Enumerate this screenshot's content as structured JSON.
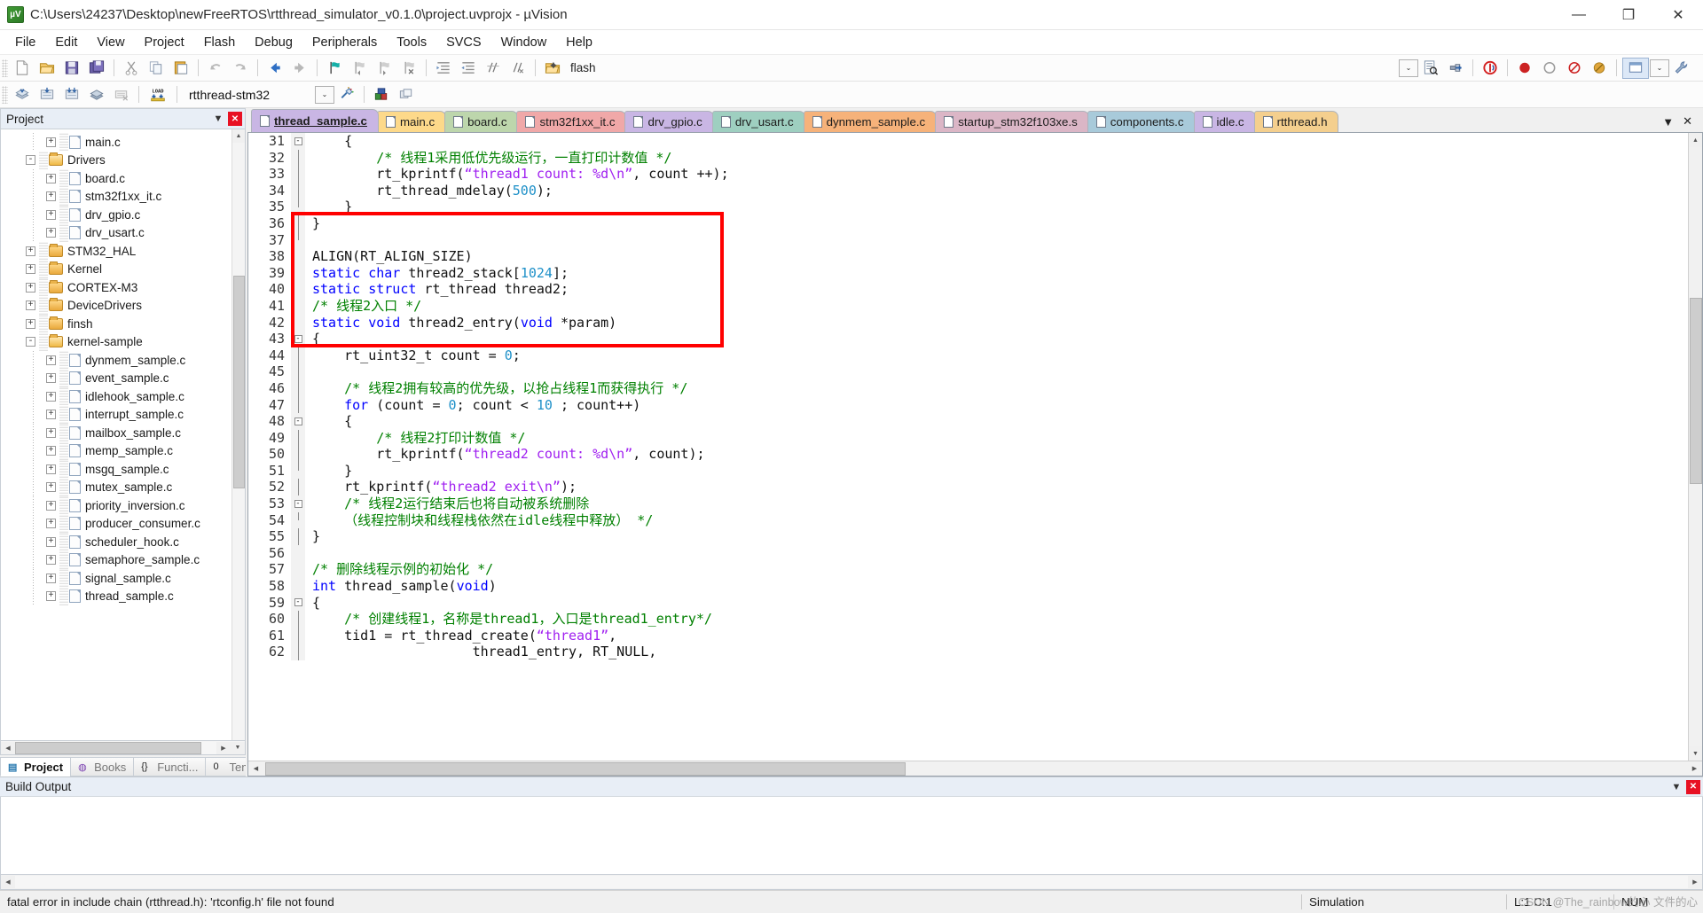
{
  "window": {
    "title": "C:\\Users\\24237\\Desktop\\newFreeRTOS\\rtthread_simulator_v0.1.0\\project.uvprojx - µVision",
    "app_icon_text": "µV",
    "minimize": "—",
    "maximize": "❐",
    "close": "✕"
  },
  "menu": {
    "items": [
      "File",
      "Edit",
      "View",
      "Project",
      "Flash",
      "Debug",
      "Peripherals",
      "Tools",
      "SVCS",
      "Window",
      "Help"
    ]
  },
  "toolbar": {
    "flash_label": "flash",
    "target_name": "rtthread-stm32",
    "load_label": "LOAD",
    "dropdown_arrow": "⌄"
  },
  "sidebar": {
    "panel_title": "Project",
    "pin": "▼",
    "close": "✕",
    "tree": [
      {
        "label": "main.c",
        "type": "file",
        "depth": 2,
        "expander": "+"
      },
      {
        "label": "Drivers",
        "type": "folder-open",
        "depth": 1,
        "expander": "-"
      },
      {
        "label": "board.c",
        "type": "file",
        "depth": 2,
        "expander": "+"
      },
      {
        "label": "stm32f1xx_it.c",
        "type": "file",
        "depth": 2,
        "expander": "+"
      },
      {
        "label": "drv_gpio.c",
        "type": "file",
        "depth": 2,
        "expander": "+"
      },
      {
        "label": "drv_usart.c",
        "type": "file",
        "depth": 2,
        "expander": "+"
      },
      {
        "label": "STM32_HAL",
        "type": "folder",
        "depth": 1,
        "expander": "+"
      },
      {
        "label": "Kernel",
        "type": "folder",
        "depth": 1,
        "expander": "+"
      },
      {
        "label": "CORTEX-M3",
        "type": "folder",
        "depth": 1,
        "expander": "+"
      },
      {
        "label": "DeviceDrivers",
        "type": "folder",
        "depth": 1,
        "expander": "+"
      },
      {
        "label": "finsh",
        "type": "folder",
        "depth": 1,
        "expander": "+"
      },
      {
        "label": "kernel-sample",
        "type": "folder-open",
        "depth": 1,
        "expander": "-"
      },
      {
        "label": "dynmem_sample.c",
        "type": "file",
        "depth": 2,
        "expander": "+"
      },
      {
        "label": "event_sample.c",
        "type": "file",
        "depth": 2,
        "expander": "+"
      },
      {
        "label": "idlehook_sample.c",
        "type": "file",
        "depth": 2,
        "expander": "+"
      },
      {
        "label": "interrupt_sample.c",
        "type": "file",
        "depth": 2,
        "expander": "+"
      },
      {
        "label": "mailbox_sample.c",
        "type": "file",
        "depth": 2,
        "expander": "+"
      },
      {
        "label": "memp_sample.c",
        "type": "file",
        "depth": 2,
        "expander": "+"
      },
      {
        "label": "msgq_sample.c",
        "type": "file",
        "depth": 2,
        "expander": "+"
      },
      {
        "label": "mutex_sample.c",
        "type": "file",
        "depth": 2,
        "expander": "+"
      },
      {
        "label": "priority_inversion.c",
        "type": "file",
        "depth": 2,
        "expander": "+"
      },
      {
        "label": "producer_consumer.c",
        "type": "file",
        "depth": 2,
        "expander": "+"
      },
      {
        "label": "scheduler_hook.c",
        "type": "file",
        "depth": 2,
        "expander": "+"
      },
      {
        "label": "semaphore_sample.c",
        "type": "file",
        "depth": 2,
        "expander": "+"
      },
      {
        "label": "signal_sample.c",
        "type": "file",
        "depth": 2,
        "expander": "+"
      },
      {
        "label": "thread_sample.c",
        "type": "file",
        "depth": 2,
        "expander": "+"
      }
    ],
    "bottom_tabs": [
      {
        "label": "Project",
        "active": true
      },
      {
        "label": "Books",
        "active": false
      },
      {
        "label": "Functi...",
        "active": false
      },
      {
        "label": "Templ...",
        "active": false
      }
    ]
  },
  "editor": {
    "tabs": [
      {
        "label": "thread_sample.c",
        "color": "#c9b6e4",
        "active": true
      },
      {
        "label": "main.c",
        "color": "#fdd98a",
        "active": false
      },
      {
        "label": "board.c",
        "color": "#bdd6ac",
        "active": false
      },
      {
        "label": "stm32f1xx_it.c",
        "color": "#f0a8a8",
        "active": false
      },
      {
        "label": "drv_gpio.c",
        "color": "#c9b6e4",
        "active": false
      },
      {
        "label": "drv_usart.c",
        "color": "#9ecfc0",
        "active": false
      },
      {
        "label": "dynmem_sample.c",
        "color": "#f6b27a",
        "active": false
      },
      {
        "label": "startup_stm32f103xe.s",
        "color": "#dbb6c6",
        "active": false
      },
      {
        "label": "components.c",
        "color": "#a8cada",
        "active": false
      },
      {
        "label": "idle.c",
        "color": "#c9b6e4",
        "active": false
      },
      {
        "label": "rtthread.h",
        "color": "#f4cf8e",
        "active": false
      }
    ],
    "tab_overflow": "▼",
    "tab_close": "✕",
    "lines": [
      {
        "no": 31,
        "fold": "minus",
        "tokens": [
          {
            "t": "    {",
            "c": "p"
          }
        ]
      },
      {
        "no": 32,
        "fold": "bar",
        "tokens": [
          {
            "t": "        /* 线程1采用低优先级运行，一直打印计数值 */",
            "c": "c"
          }
        ]
      },
      {
        "no": 33,
        "fold": "bar",
        "tokens": [
          {
            "t": "        rt_kprintf(",
            "c": "p"
          },
          {
            "t": "“thread1 count: %d\\n”",
            "c": "s"
          },
          {
            "t": ", count ++);",
            "c": "p"
          }
        ]
      },
      {
        "no": 34,
        "fold": "bar",
        "tokens": [
          {
            "t": "        rt_thread_mdelay(",
            "c": "p"
          },
          {
            "t": "500",
            "c": "n"
          },
          {
            "t": ");",
            "c": "p"
          }
        ]
      },
      {
        "no": 35,
        "fold": "end",
        "tokens": [
          {
            "t": "    }",
            "c": "p"
          }
        ]
      },
      {
        "no": 36,
        "fold": "bar",
        "tokens": [
          {
            "t": "}",
            "c": "p"
          }
        ]
      },
      {
        "no": 37,
        "fold": "end",
        "tokens": [
          {
            "t": "",
            "c": "p"
          }
        ]
      },
      {
        "no": 38,
        "fold": "none",
        "tokens": [
          {
            "t": "ALIGN(RT_ALIGN_SIZE)",
            "c": "p"
          }
        ]
      },
      {
        "no": 39,
        "fold": "none",
        "tokens": [
          {
            "t": "static char",
            "c": "k"
          },
          {
            "t": " thread2_stack[",
            "c": "p"
          },
          {
            "t": "1024",
            "c": "n"
          },
          {
            "t": "];",
            "c": "p"
          }
        ]
      },
      {
        "no": 40,
        "fold": "none",
        "tokens": [
          {
            "t": "static struct",
            "c": "k"
          },
          {
            "t": " rt_thread thread2;",
            "c": "p"
          }
        ]
      },
      {
        "no": 41,
        "fold": "none",
        "tokens": [
          {
            "t": "/* 线程2入口 */",
            "c": "c"
          }
        ]
      },
      {
        "no": 42,
        "fold": "none",
        "tokens": [
          {
            "t": "static void",
            "c": "k"
          },
          {
            "t": " thread2_entry(",
            "c": "p"
          },
          {
            "t": "void",
            "c": "k"
          },
          {
            "t": " *param)",
            "c": "p"
          }
        ]
      },
      {
        "no": 43,
        "fold": "minus",
        "tokens": [
          {
            "t": "{",
            "c": "p"
          }
        ]
      },
      {
        "no": 44,
        "fold": "bar",
        "tokens": [
          {
            "t": "    rt_uint32_t count = ",
            "c": "p"
          },
          {
            "t": "0",
            "c": "n"
          },
          {
            "t": ";",
            "c": "p"
          }
        ]
      },
      {
        "no": 45,
        "fold": "bar",
        "tokens": [
          {
            "t": "",
            "c": "p"
          }
        ]
      },
      {
        "no": 46,
        "fold": "bar",
        "tokens": [
          {
            "t": "    /* 线程2拥有较高的优先级，以抢占线程1而获得执行 */",
            "c": "c"
          }
        ]
      },
      {
        "no": 47,
        "fold": "bar",
        "tokens": [
          {
            "t": "    ",
            "c": "p"
          },
          {
            "t": "for",
            "c": "k"
          },
          {
            "t": " (count = ",
            "c": "p"
          },
          {
            "t": "0",
            "c": "n"
          },
          {
            "t": "; count < ",
            "c": "p"
          },
          {
            "t": "10",
            "c": "n"
          },
          {
            "t": " ; count++)",
            "c": "p"
          }
        ]
      },
      {
        "no": 48,
        "fold": "minus",
        "tokens": [
          {
            "t": "    {",
            "c": "p"
          }
        ]
      },
      {
        "no": 49,
        "fold": "bar",
        "tokens": [
          {
            "t": "        /* 线程2打印计数值 */",
            "c": "c"
          }
        ]
      },
      {
        "no": 50,
        "fold": "bar",
        "tokens": [
          {
            "t": "        rt_kprintf(",
            "c": "p"
          },
          {
            "t": "“thread2 count: %d\\n”",
            "c": "s"
          },
          {
            "t": ", count);",
            "c": "p"
          }
        ]
      },
      {
        "no": 51,
        "fold": "end",
        "tokens": [
          {
            "t": "    }",
            "c": "p"
          }
        ]
      },
      {
        "no": 52,
        "fold": "bar",
        "tokens": [
          {
            "t": "    rt_kprintf(",
            "c": "p"
          },
          {
            "t": "“thread2 exit\\n”",
            "c": "s"
          },
          {
            "t": ");",
            "c": "p"
          }
        ]
      },
      {
        "no": 53,
        "fold": "minus",
        "tokens": [
          {
            "t": "    /* 线程2运行结束后也将自动被系统删除",
            "c": "c"
          }
        ]
      },
      {
        "no": 54,
        "fold": "end",
        "tokens": [
          {
            "t": "    （线程控制块和线程栈依然在idle线程中释放） */",
            "c": "c"
          }
        ]
      },
      {
        "no": 55,
        "fold": "bar",
        "tokens": [
          {
            "t": "}",
            "c": "p"
          }
        ]
      },
      {
        "no": 56,
        "fold": "none",
        "tokens": [
          {
            "t": "",
            "c": "p"
          }
        ]
      },
      {
        "no": 57,
        "fold": "none",
        "tokens": [
          {
            "t": "/* 删除线程示例的初始化 */",
            "c": "c"
          }
        ]
      },
      {
        "no": 58,
        "fold": "none",
        "tokens": [
          {
            "t": "int",
            "c": "k"
          },
          {
            "t": " thread_sample(",
            "c": "p"
          },
          {
            "t": "void",
            "c": "k"
          },
          {
            "t": ")",
            "c": "p"
          }
        ]
      },
      {
        "no": 59,
        "fold": "minus",
        "tokens": [
          {
            "t": "{",
            "c": "p"
          }
        ]
      },
      {
        "no": 60,
        "fold": "bar",
        "tokens": [
          {
            "t": "    /* 创建线程1，名称是thread1，入口是thread1_entry*/",
            "c": "c"
          }
        ]
      },
      {
        "no": 61,
        "fold": "bar",
        "tokens": [
          {
            "t": "    tid1 = rt_thread_create(",
            "c": "p"
          },
          {
            "t": "“thread1”",
            "c": "s"
          },
          {
            "t": ",",
            "c": "p"
          }
        ]
      },
      {
        "no": 62,
        "fold": "bar",
        "tokens": [
          {
            "t": "                    thread1_entry, RT_NULL,",
            "c": "p"
          }
        ]
      }
    ],
    "annotation_color": "#ff0000"
  },
  "build_output": {
    "title": "Build Output",
    "pin": "▼",
    "close": "✕",
    "content": ""
  },
  "statusbar": {
    "message": "fatal error in include chain (rtthread.h): 'rtconfig.h' file not found",
    "simulation": "Simulation",
    "position": "L:1 C:1",
    "caps": "NUM",
    "watermark": "CSDN @The_rainbow的心 文件的心"
  }
}
